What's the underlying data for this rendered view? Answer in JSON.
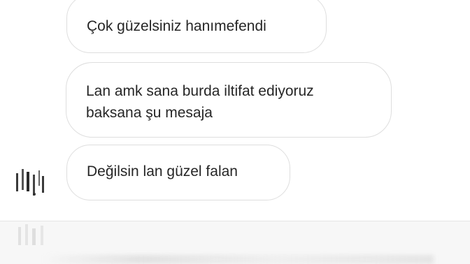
{
  "messages": [
    {
      "lines": [
        "Çok güzelsiniz hanımefendi"
      ]
    },
    {
      "lines": [
        "Lan amk sana burda iltifat ediyoruz",
        "baksana şu mesaja"
      ]
    },
    {
      "lines": [
        "Değilsin lan güzel falan"
      ]
    }
  ],
  "icons": {
    "avatar": "avatar-icon"
  },
  "colors": {
    "bubble_border": "#dedede",
    "text": "#262626",
    "composer_bg": "#f7f7f7"
  }
}
